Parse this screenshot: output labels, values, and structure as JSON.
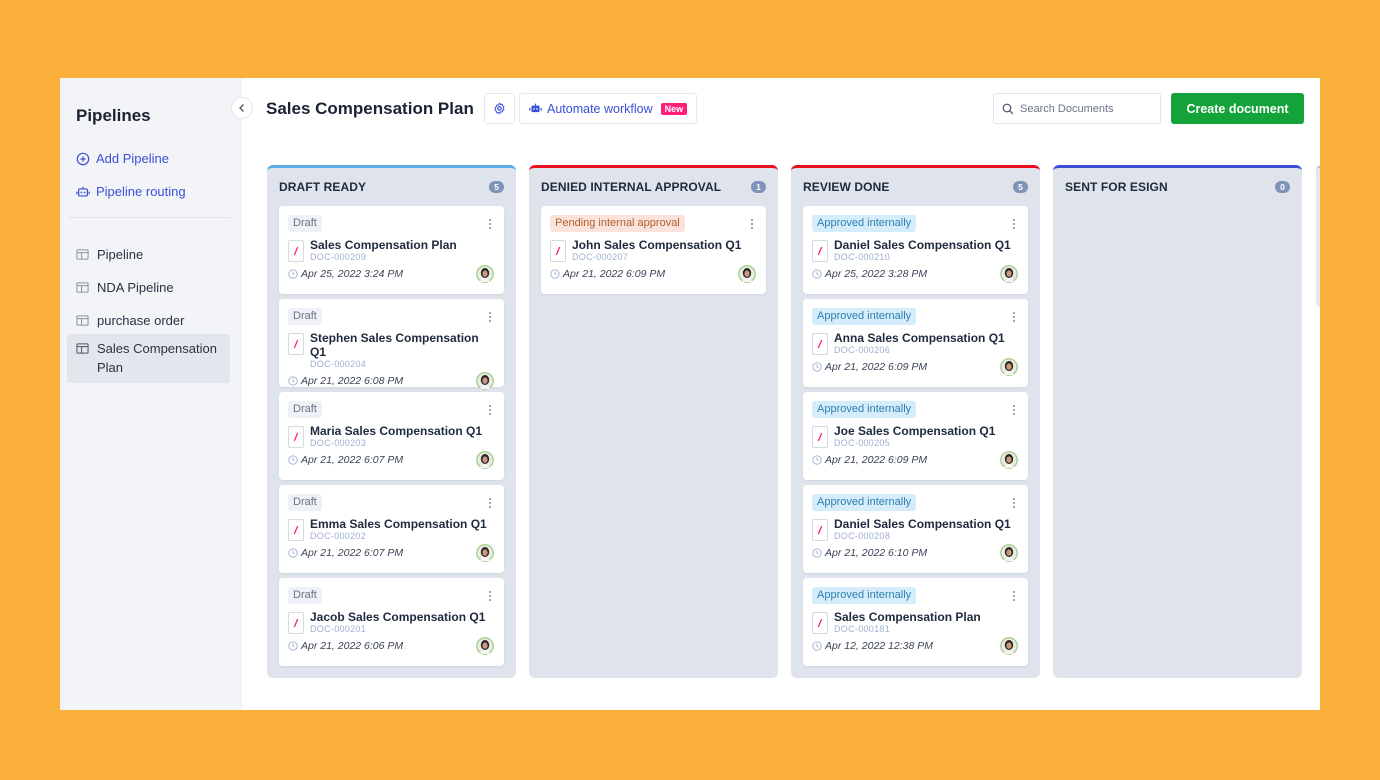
{
  "sidebar": {
    "title": "Pipelines",
    "actions": [
      {
        "label": "Add Pipeline",
        "icon": "plus-circle-icon"
      },
      {
        "label": "Pipeline routing",
        "icon": "robot-icon"
      }
    ],
    "items": [
      {
        "label": "Pipeline",
        "icon": "table-icon",
        "active": false
      },
      {
        "label": "NDA Pipeline",
        "icon": "table-icon",
        "active": false
      },
      {
        "label": "purchase order",
        "icon": "table-icon",
        "active": false
      },
      {
        "label": "Sales Compensation Plan",
        "icon": "table-icon",
        "active": true
      }
    ]
  },
  "header": {
    "title": "Sales Compensation Plan",
    "settings_icon": "gear-icon",
    "automate_label": "Automate workflow",
    "new_badge": "New",
    "search_placeholder": "Search Documents",
    "search_value": "",
    "create_label": "Create document"
  },
  "colors": {
    "accent": "#3b4fd8",
    "create_button": "#14a33a",
    "new_badge": "#ff1f7a",
    "background_frame": "#FBB03B"
  },
  "columns": [
    {
      "title": "DRAFT READY",
      "count": "5",
      "border_color": "#5aaee8",
      "cards": [
        {
          "status": "Draft",
          "title": "Sales Compensation Plan",
          "doc_id": "DOC-000209",
          "date": "Apr 25, 2022 3:24 PM"
        },
        {
          "status": "Draft",
          "title": "Stephen Sales Compensation Q1",
          "doc_id": "DOC-000204",
          "date": "Apr 21, 2022 6:08 PM"
        },
        {
          "status": "Draft",
          "title": "Maria Sales Compensation Q1",
          "doc_id": "DOC-000203",
          "date": "Apr 21, 2022 6:07 PM"
        },
        {
          "status": "Draft",
          "title": "Emma Sales Compensation Q1",
          "doc_id": "DOC-000202",
          "date": "Apr 21, 2022 6:07 PM"
        },
        {
          "status": "Draft",
          "title": "Jacob Sales Compensation Q1",
          "doc_id": "DOC-000201",
          "date": "Apr 21, 2022 6:06 PM"
        }
      ]
    },
    {
      "title": "DENIED INTERNAL APPROVAL",
      "count": "1",
      "border_color": "#e8101e",
      "cards": [
        {
          "status": "Pending internal approval",
          "title": "John Sales Compensation Q1",
          "doc_id": "DOC-000207",
          "date": "Apr 21, 2022 6:09 PM"
        }
      ]
    },
    {
      "title": "REVIEW DONE",
      "count": "5",
      "border_color": "#e8101e",
      "cards": [
        {
          "status": "Approved internally",
          "title": "Daniel Sales Compensation Q1",
          "doc_id": "DOC-000210",
          "date": "Apr 25, 2022 3:28 PM"
        },
        {
          "status": "Approved internally",
          "title": "Anna Sales Compensation Q1",
          "doc_id": "DOC-000206",
          "date": "Apr 21, 2022 6:09 PM"
        },
        {
          "status": "Approved internally",
          "title": "Joe Sales Compensation Q1",
          "doc_id": "DOC-000205",
          "date": "Apr 21, 2022 6:09 PM"
        },
        {
          "status": "Approved internally",
          "title": "Daniel Sales Compensation Q1",
          "doc_id": "DOC-000208",
          "date": "Apr 21, 2022 6:10 PM"
        },
        {
          "status": "Approved internally",
          "title": "Sales Compensation Plan",
          "doc_id": "DOC-000181",
          "date": "Apr 12, 2022 12:38 PM"
        }
      ]
    },
    {
      "title": "SENT FOR ESIGN",
      "count": "0",
      "border_color": "#3b4fd8",
      "cards": []
    }
  ],
  "status_styles": {
    "Draft": {
      "bg": "#EEF1F5",
      "fg": "#6b7385"
    },
    "Pending internal approval": {
      "bg": "#FBE3DC",
      "fg": "#b0602c"
    },
    "Approved internally": {
      "bg": "#D5EDFA",
      "fg": "#2f7fb0"
    }
  }
}
